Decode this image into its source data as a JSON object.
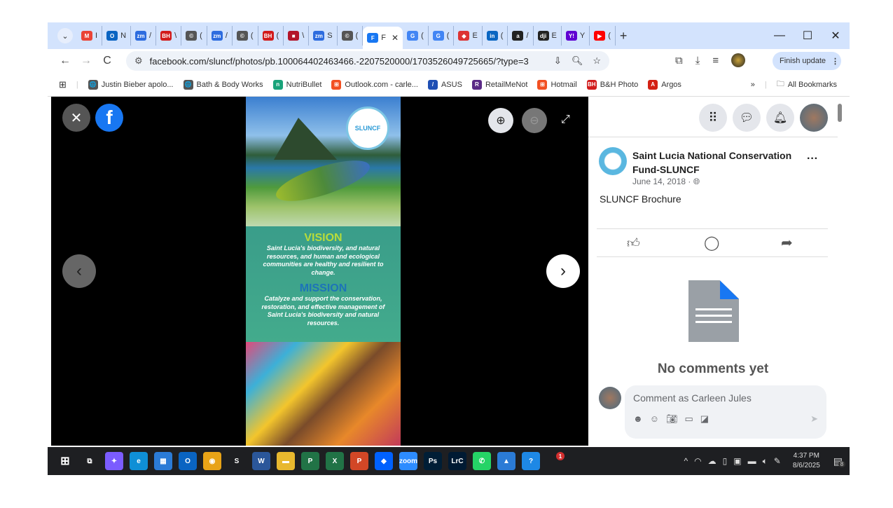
{
  "browser": {
    "tabs": [
      {
        "icon": "gmail",
        "glyph": "M",
        "color": "#ea4335",
        "title": "I"
      },
      {
        "icon": "outlook",
        "glyph": "O",
        "color": "#0a64c2",
        "title": "N"
      },
      {
        "icon": "zoom",
        "glyph": "zm",
        "color": "#2d6cdf",
        "title": "/"
      },
      {
        "icon": "bh",
        "glyph": "BH",
        "color": "#d21c1c",
        "title": "\\"
      },
      {
        "icon": "copyright",
        "glyph": "©",
        "color": "#555",
        "title": "("
      },
      {
        "icon": "zoom",
        "glyph": "zm",
        "color": "#2d6cdf",
        "title": "/"
      },
      {
        "icon": "copyright",
        "glyph": "©",
        "color": "#555",
        "title": "("
      },
      {
        "icon": "bh",
        "glyph": "BH",
        "color": "#d21c1c",
        "title": "("
      },
      {
        "icon": "red-square",
        "glyph": "■",
        "color": "#b3142a",
        "title": "\\"
      },
      {
        "icon": "zoom",
        "glyph": "zm",
        "color": "#2d6cdf",
        "title": "S"
      },
      {
        "icon": "copyright",
        "glyph": "©",
        "color": "#555",
        "title": "("
      },
      {
        "icon": "facebook",
        "glyph": "F",
        "color": "#fff",
        "title": "F",
        "active": true
      },
      {
        "icon": "google",
        "glyph": "G",
        "color": "#4285f4",
        "title": "("
      },
      {
        "icon": "google",
        "glyph": "G",
        "color": "#4285f4",
        "title": "("
      },
      {
        "icon": "bank",
        "glyph": "◆",
        "color": "#d33",
        "title": "E"
      },
      {
        "icon": "linkedin",
        "glyph": "in",
        "color": "#0a66c2",
        "title": "("
      },
      {
        "icon": "amazon",
        "glyph": "a",
        "color": "#222",
        "title": "/"
      },
      {
        "icon": "dji",
        "glyph": "dji",
        "color": "#222",
        "title": "E"
      },
      {
        "icon": "yahoo",
        "glyph": "Y!",
        "color": "#6001d2",
        "title": "Y"
      },
      {
        "icon": "youtube",
        "glyph": "▶",
        "color": "#f00",
        "title": "("
      }
    ],
    "new_tab": "+",
    "url": "facebook.com/sluncf/photos/pb.100064402463466.-2207520000/1703526049725665/?type=3",
    "finish_update": "Finish update",
    "bookmarks": [
      {
        "label": "Justin Bieber apolo...",
        "glyph": "🌐",
        "color": "#555"
      },
      {
        "label": "Bath & Body Works",
        "glyph": "🌐",
        "color": "#555"
      },
      {
        "label": "NutriBullet",
        "glyph": "n",
        "color": "#1aa37a"
      },
      {
        "label": "Outlook.com - carle...",
        "glyph": "⊞",
        "color": "#f25022"
      },
      {
        "label": "ASUS",
        "glyph": "/",
        "color": "#1f4fb4"
      },
      {
        "label": "RetailMeNot",
        "glyph": "R",
        "color": "#5b2a86"
      },
      {
        "label": "Hotmail",
        "glyph": "⊞",
        "color": "#f25022"
      },
      {
        "label": "B&H Photo",
        "glyph": "BH",
        "color": "#d21c1c"
      },
      {
        "label": "Argos",
        "glyph": "A",
        "color": "#d42114"
      }
    ],
    "more": "»",
    "all_bookmarks": "All Bookmarks"
  },
  "brochure": {
    "logo": "SLUNCF",
    "vision_title": "VISION",
    "vision_text": "Saint Lucia's biodiversity, and natural resources, and human and ecological communities are healthy and resilient to change.",
    "mission_title": "MISSION",
    "mission_text": "Catalyze and support the conservation, restoration, and effective management of Saint Lucia's biodiversity and natural resources."
  },
  "post": {
    "page_name": "Saint Lucia National Conservation Fund-SLUNCF",
    "date": "June 14, 2018 ·",
    "caption": "SLUNCF Brochure",
    "no_comments": "No comments yet",
    "comment_placeholder": "Comment as Carleen Jules"
  },
  "taskbar": {
    "time": "4:37 PM",
    "date": "8/6/2025",
    "notification_count": "8",
    "apps": [
      {
        "name": "task-view",
        "glyph": "⧉",
        "color": "#1e1f22"
      },
      {
        "name": "copilot",
        "glyph": "✦",
        "color": "#7b5cff"
      },
      {
        "name": "edge",
        "glyph": "e",
        "color": "#0f8fd6"
      },
      {
        "name": "store",
        "glyph": "▦",
        "color": "#2b7bd6"
      },
      {
        "name": "outlook",
        "glyph": "O",
        "color": "#0a64c2"
      },
      {
        "name": "chrome",
        "glyph": "◉",
        "color": "#e8a317"
      },
      {
        "name": "app-s",
        "glyph": "S",
        "color": "#1e1f22"
      },
      {
        "name": "word",
        "glyph": "W",
        "color": "#2b579a"
      },
      {
        "name": "file-explorer",
        "glyph": "▬",
        "color": "#e8b82e"
      },
      {
        "name": "project",
        "glyph": "P",
        "color": "#217346"
      },
      {
        "name": "excel",
        "glyph": "X",
        "color": "#217346"
      },
      {
        "name": "powerpoint",
        "glyph": "P",
        "color": "#d24726"
      },
      {
        "name": "dropbox",
        "glyph": "◆",
        "color": "#0061fe"
      },
      {
        "name": "zoom",
        "glyph": "zoom",
        "color": "#2d8cff"
      },
      {
        "name": "photoshop",
        "glyph": "Ps",
        "color": "#001e36"
      },
      {
        "name": "lightroom-classic",
        "glyph": "LrC",
        "color": "#001a33"
      },
      {
        "name": "whatsapp",
        "glyph": "✆",
        "color": "#25d366"
      },
      {
        "name": "photos",
        "glyph": "▲",
        "color": "#2b7bd6"
      },
      {
        "name": "help",
        "glyph": "?",
        "color": "#1e88e5"
      }
    ],
    "badge": "1"
  }
}
